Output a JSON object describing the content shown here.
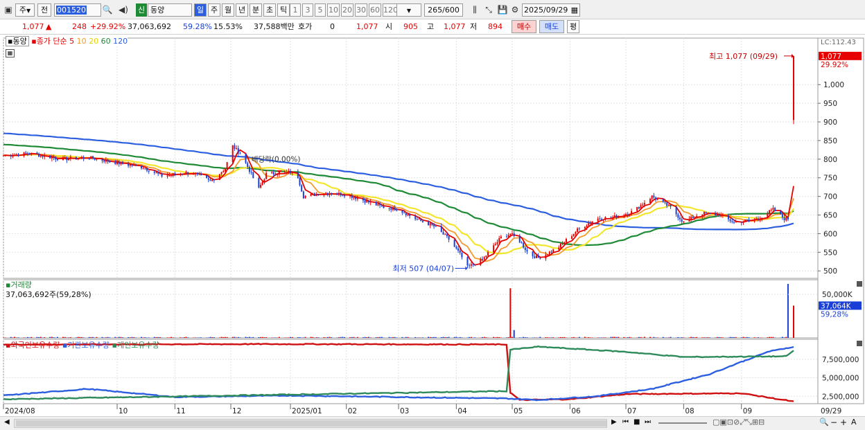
{
  "toolbar": {
    "market_label": "주",
    "prefix_label": "전",
    "code_value": "001520",
    "credit_badge": "신",
    "name_value": "동양",
    "period_tabs": [
      "일",
      "주",
      "월",
      "년",
      "분",
      "초",
      "틱"
    ],
    "interval_buttons": [
      "1",
      "3",
      "5",
      "10",
      "20",
      "30",
      "60",
      "120"
    ],
    "count_value": "265",
    "count_max": "/600",
    "date_value": "2025/09/29"
  },
  "quote": {
    "price": "1,077",
    "change": "248",
    "change_pct": "+29.92%",
    "volume": "37,063,692",
    "vol_ratio": "59.28%",
    "turnover": "15.53%",
    "amount": "37,588백만",
    "hoga_label": "호가",
    "hoga_value": "0",
    "hoga_price": "1,077",
    "open_label": "시",
    "open_value": "905",
    "high_label": "고",
    "high_value": "1,077",
    "low_label": "저",
    "low_value": "894",
    "buy_label": "매수",
    "sell_label": "매도",
    "eval_label": "평"
  },
  "colors": {
    "up": "#e60000",
    "down": "#1a3fd6",
    "ma5": "#e60000",
    "ma10": "#f39a2c",
    "ma20": "#f3e62c",
    "ma60": "#1e8a36",
    "ma120": "#2c5ee0",
    "foreign": "#d01010",
    "institution": "#2c5ee0",
    "individual": "#2e8a5a"
  },
  "chart_data": [
    {
      "type": "candlestick",
      "title": "동양",
      "legend": [
        "종가 단순 5",
        "10",
        "20",
        "60",
        "120"
      ],
      "ylim": [
        480,
        1125
      ],
      "y_ticks": [
        500,
        550,
        600,
        650,
        700,
        750,
        800,
        850,
        900,
        950,
        1000
      ],
      "x_ticks": [
        "2024/08",
        "10",
        "11",
        "12",
        "2025/01",
        "02",
        "03",
        "04",
        "05",
        "06",
        "07",
        "08",
        "09",
        "09/29"
      ],
      "annotations": {
        "high_text": "최고 1,077 (09/29)",
        "low_text": "최저 507 (04/07)",
        "dividend_text": "배당락(0.00%)",
        "limit_text": "LC:112.43",
        "last_price_label": "1,077",
        "last_pct_label": "29.92%"
      },
      "close_points": [
        [
          "2024-08-01",
          810
        ],
        [
          "2024-08-15",
          815
        ],
        [
          "2024-09-01",
          800
        ],
        [
          "2024-09-15",
          805
        ],
        [
          "2024-10-01",
          790
        ],
        [
          "2024-10-15",
          778
        ],
        [
          "2024-10-25",
          755
        ],
        [
          "2024-11-10",
          765
        ],
        [
          "2024-11-20",
          740
        ],
        [
          "2024-11-28",
          775
        ],
        [
          "2024-12-02",
          835
        ],
        [
          "2024-12-06",
          815
        ],
        [
          "2024-12-10",
          780
        ],
        [
          "2024-12-16",
          720
        ],
        [
          "2024-12-20",
          760
        ],
        [
          "2025-01-02",
          765
        ],
        [
          "2025-01-06",
          752
        ],
        [
          "2025-01-09",
          700
        ],
        [
          "2025-01-20",
          710
        ],
        [
          "2025-02-01",
          705
        ],
        [
          "2025-02-10",
          690
        ],
        [
          "2025-02-20",
          672
        ],
        [
          "2025-03-01",
          665
        ],
        [
          "2025-03-10",
          640
        ],
        [
          "2025-03-20",
          620
        ],
        [
          "2025-03-28",
          585
        ],
        [
          "2025-04-03",
          545
        ],
        [
          "2025-04-07",
          510
        ],
        [
          "2025-04-15",
          530
        ],
        [
          "2025-04-25",
          590
        ],
        [
          "2025-04-30",
          600
        ],
        [
          "2025-05-05",
          580
        ],
        [
          "2025-05-10",
          545
        ],
        [
          "2025-05-15",
          535
        ],
        [
          "2025-05-25",
          560
        ],
        [
          "2025-06-05",
          610
        ],
        [
          "2025-06-15",
          640
        ],
        [
          "2025-06-25",
          645
        ],
        [
          "2025-07-05",
          660
        ],
        [
          "2025-07-15",
          700
        ],
        [
          "2025-07-25",
          670
        ],
        [
          "2025-08-01",
          630
        ],
        [
          "2025-08-10",
          655
        ],
        [
          "2025-08-20",
          650
        ],
        [
          "2025-08-28",
          630
        ],
        [
          "2025-09-10",
          640
        ],
        [
          "2025-09-18",
          665
        ],
        [
          "2025-09-24",
          640
        ],
        [
          "2025-09-26",
          640
        ],
        [
          "2025-09-29",
          1077
        ]
      ]
    },
    {
      "type": "bar",
      "title": "거래량",
      "info_text": "37,063,692주(59,28%)",
      "y_ticks": [
        "50,000K"
      ],
      "last_label": "37,064K",
      "last_pct_label": "59,28%",
      "ylim": [
        0,
        62000
      ],
      "peaks": [
        [
          "2025-04-30",
          57000
        ],
        [
          "2025-05-02",
          9000
        ],
        [
          "2025-09-26",
          62000
        ],
        [
          "2025-09-29",
          37064
        ]
      ]
    },
    {
      "type": "line",
      "legend": [
        "외국인보유수량",
        "기관보유수량",
        "개인보유수량"
      ],
      "y_ticks": [
        "2,500,000",
        "5,000,000",
        "7,500,000"
      ],
      "ylim": [
        1500000,
        10200000
      ],
      "series": [
        {
          "name": "외국인보유수량",
          "points": [
            [
              "2024-08-01",
              9500000
            ],
            [
              "2025-01-01",
              9550000
            ],
            [
              "2025-04-28",
              9500000
            ],
            [
              "2025-04-30",
              3000000
            ],
            [
              "2025-05-05",
              2000000
            ],
            [
              "2025-06-01",
              2100000
            ],
            [
              "2025-07-01",
              2800000
            ],
            [
              "2025-09-01",
              2900000
            ],
            [
              "2025-09-29",
              1800000
            ]
          ]
        },
        {
          "name": "기관보유수량",
          "points": [
            [
              "2024-08-01",
              2600000
            ],
            [
              "2024-09-15",
              3500000
            ],
            [
              "2024-11-01",
              2400000
            ],
            [
              "2025-01-01",
              2600000
            ],
            [
              "2025-04-28",
              2200000
            ],
            [
              "2025-05-15",
              2000000
            ],
            [
              "2025-06-15",
              2500000
            ],
            [
              "2025-07-15",
              3500000
            ],
            [
              "2025-08-15",
              5500000
            ],
            [
              "2025-09-15",
              8500000
            ],
            [
              "2025-09-29",
              9200000
            ]
          ]
        },
        {
          "name": "개인보유수량",
          "points": [
            [
              "2024-08-01",
              2100000
            ],
            [
              "2025-04-28",
              3200000
            ],
            [
              "2025-04-30",
              8800000
            ],
            [
              "2025-05-15",
              9200000
            ],
            [
              "2025-07-01",
              8500000
            ],
            [
              "2025-08-01",
              7800000
            ],
            [
              "2025-09-25",
              7900000
            ],
            [
              "2025-09-29",
              8700000
            ]
          ]
        }
      ]
    }
  ]
}
